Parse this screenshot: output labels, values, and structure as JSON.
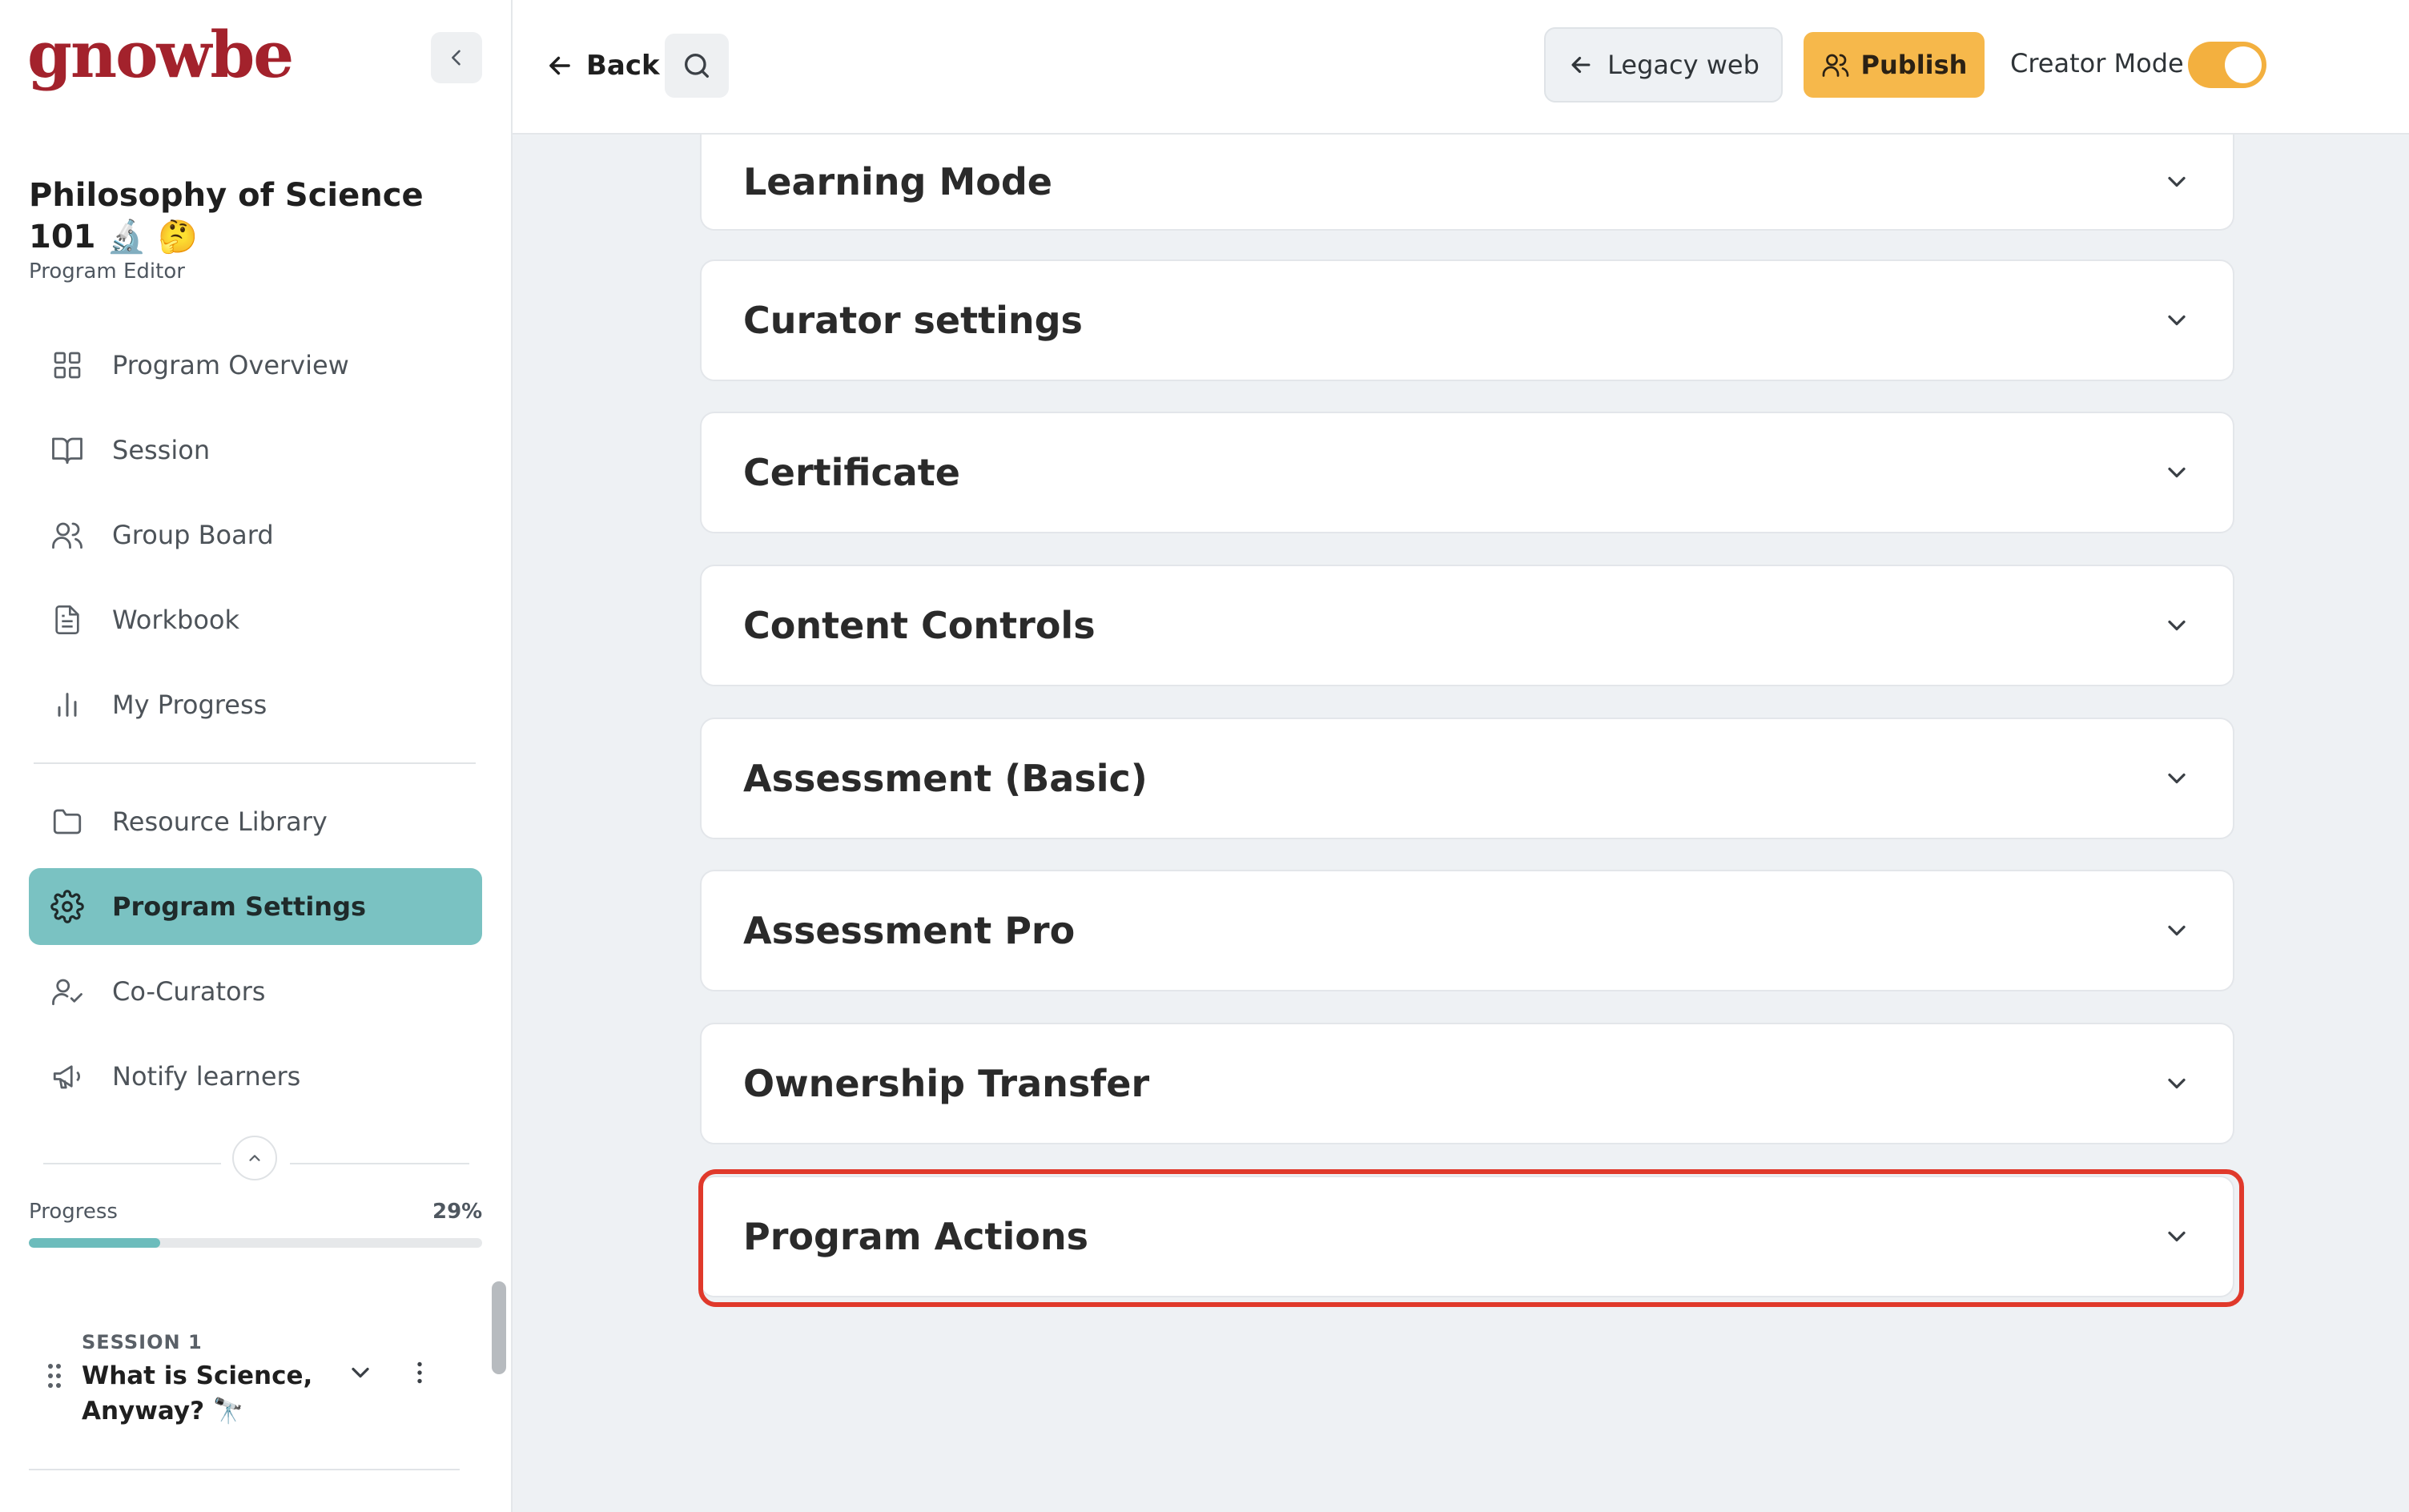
{
  "sidebar": {
    "logo": "gnowbe",
    "program_title": "Philosophy of Science 101 🔬 🤔",
    "program_subtitle": "Program Editor",
    "nav_primary": [
      {
        "label": "Program Overview",
        "icon": "grid-icon"
      },
      {
        "label": "Session",
        "icon": "book-icon"
      },
      {
        "label": "Group Board",
        "icon": "users-icon"
      },
      {
        "label": "Workbook",
        "icon": "document-icon"
      },
      {
        "label": "My Progress",
        "icon": "bar-chart-icon"
      }
    ],
    "nav_secondary": [
      {
        "label": "Resource Library",
        "icon": "folder-icon"
      },
      {
        "label": "Program Settings",
        "icon": "gear-icon",
        "active": true
      },
      {
        "label": "Co-Curators",
        "icon": "user-check-icon"
      },
      {
        "label": "Notify learners",
        "icon": "megaphone-icon"
      }
    ],
    "progress": {
      "label": "Progress",
      "value_text": "29%",
      "fraction": 0.29
    },
    "session": {
      "kicker": "SESSION 1",
      "title": "What is Science, Anyway? 🔭"
    }
  },
  "topbar": {
    "back_label": "Back",
    "legacy_label": "Legacy web",
    "publish_label": "Publish",
    "creator_mode_label": "Creator Mode",
    "creator_mode_on": true
  },
  "settings_sections": [
    "Learning Mode",
    "Curator settings",
    "Certificate",
    "Content Controls",
    "Assessment (Basic)",
    "Assessment Pro",
    "Ownership Transfer",
    "Program Actions"
  ],
  "colors": {
    "brand": "#a3222c",
    "accent_teal": "#7ac2c2",
    "publish_yellow": "#f6b84b",
    "highlight_red": "#e0392b"
  }
}
